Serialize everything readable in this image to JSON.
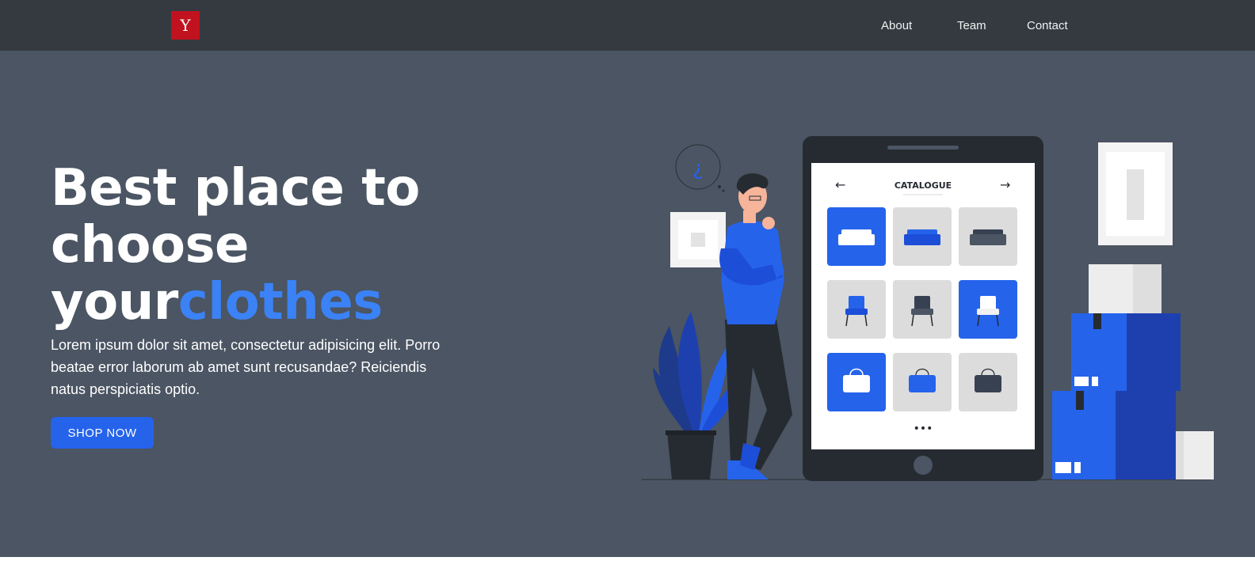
{
  "navbar": {
    "logo_letter": "Y",
    "links": [
      {
        "label": "About"
      },
      {
        "label": "Team"
      },
      {
        "label": "Contact"
      }
    ]
  },
  "hero": {
    "headline_line1": "Best place to",
    "headline_line2": "choose",
    "headline_line3_plain": "your",
    "headline_line3_accent": "clothes",
    "lead": "Lorem ipsum dolor sit amet, consectetur adipisicing elit. Porro beatae error laborum ab amet sunt recusandae? Reiciendis natus perspiciatis optio.",
    "cta_label": "SHOP NOW"
  },
  "illustration": {
    "catalogue_title": "CATALOGUE",
    "prev_arrow": "←",
    "next_arrow": "→",
    "more_dots": "•••"
  },
  "colors": {
    "navbar_bg": "#343a40",
    "hero_bg": "#4b5563",
    "accent": "#3b82f6",
    "button": "#2563eb",
    "logo": "#c1121f"
  }
}
